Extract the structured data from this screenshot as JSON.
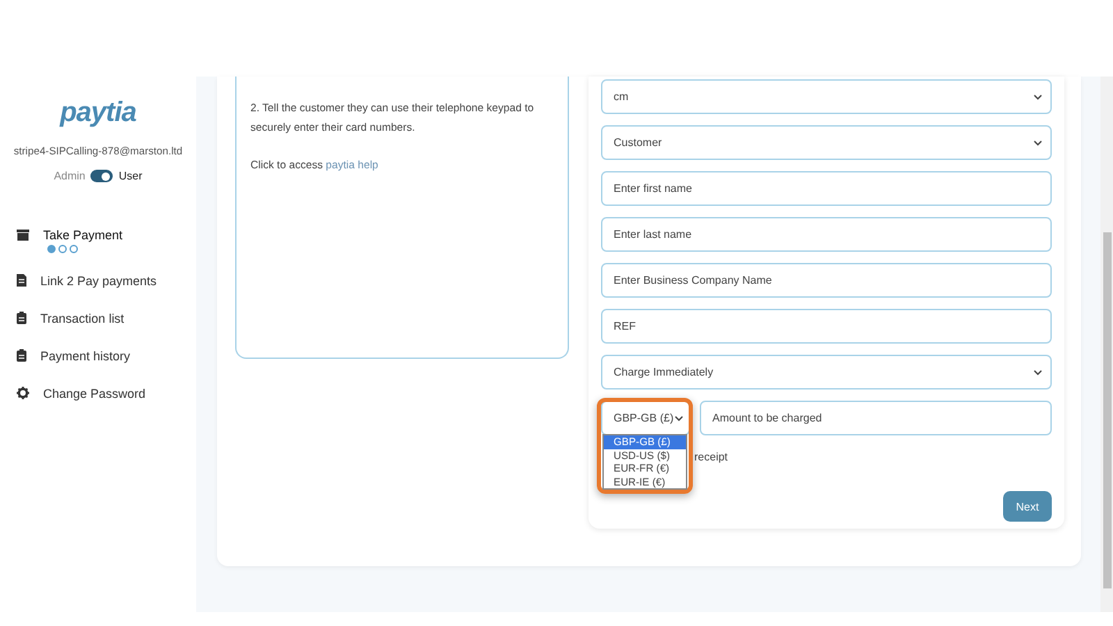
{
  "sidebar": {
    "logo": "paytia",
    "account": "stripe4-SIPCalling-878@marston.ltd",
    "mode_toggle": {
      "left_label": "Admin",
      "right_label": "User",
      "on": true
    },
    "items": [
      {
        "label": "Take Payment",
        "kind": "archive",
        "selected": true,
        "steps": [
          {
            "selected": true
          },
          {
            "selected": false
          },
          {
            "selected": false
          }
        ]
      },
      {
        "label": "Link 2 Pay payments",
        "kind": "document",
        "selected": false
      },
      {
        "label": "Transaction list",
        "kind": "clipboard",
        "selected": false
      },
      {
        "label": "Payment history",
        "kind": "clipboard",
        "selected": false
      },
      {
        "label": "Change Password",
        "kind": "gear",
        "selected": false
      }
    ]
  },
  "help": {
    "step_text": "2. Tell the customer they can use their telephone keypad to securely enter their card numbers.",
    "link_prefix": "Click to access",
    "link": "paytia help"
  },
  "form": {
    "fields": [
      {
        "kind": "select",
        "value": "cm"
      },
      {
        "kind": "select",
        "value": "Customer"
      },
      {
        "kind": "input",
        "placeholder": "Enter first name"
      },
      {
        "kind": "input",
        "placeholder": "Enter last name"
      },
      {
        "kind": "input",
        "placeholder": "Enter Business Company Name"
      },
      {
        "kind": "input",
        "value": "REF"
      },
      {
        "kind": "select",
        "value": "Charge Immediately"
      }
    ],
    "currency": {
      "value": "GBP-GB (£)",
      "highlighted": true,
      "options": [
        {
          "label": "GBP-GB (£)",
          "selected": true
        },
        {
          "label": "USD-US ($)",
          "selected": false
        },
        {
          "label": "EUR-FR (€)",
          "selected": false
        },
        {
          "label": "EUR-IE (€)",
          "selected": false
        }
      ]
    },
    "amount": {
      "placeholder": "Amount to be charged"
    },
    "receipt_label": "receipt",
    "next_button": "Next"
  }
}
